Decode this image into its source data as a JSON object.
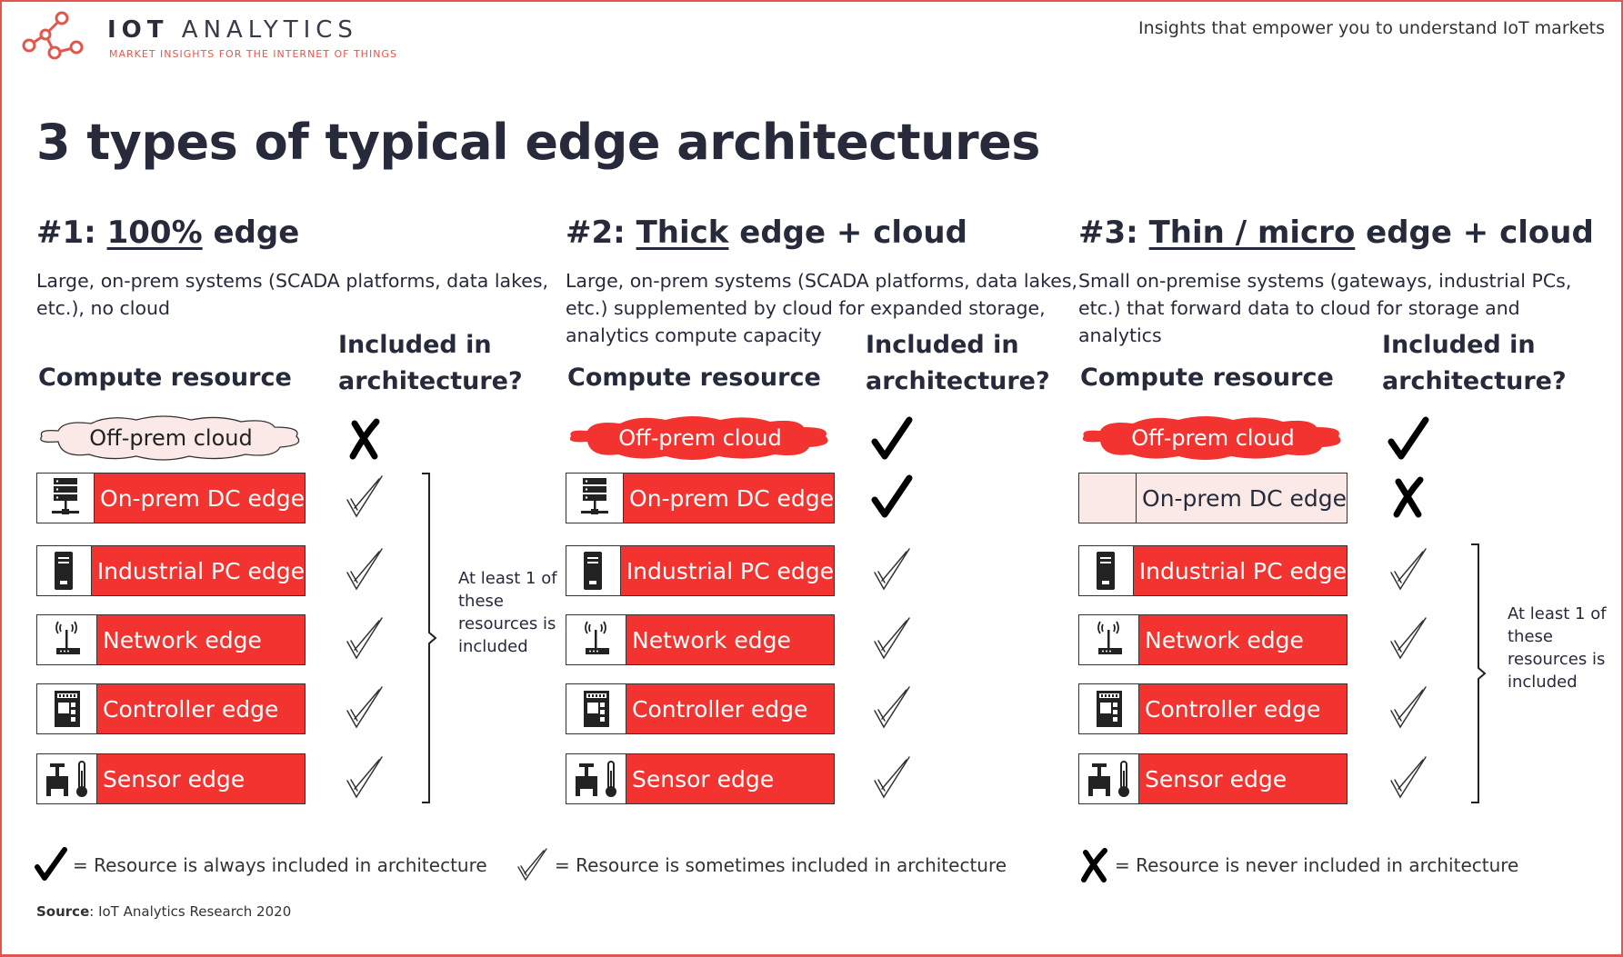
{
  "header": {
    "brand_bold": "IOT",
    "brand_light": "ANALYTICS",
    "brand_subtitle": "MARKET INSIGHTS FOR THE INTERNET OF THINGS",
    "tagline": "Insights that empower you to understand IoT markets"
  },
  "title": "3 types of typical edge architectures",
  "labels": {
    "compute_resource": "Compute resource",
    "included_line1": "Included in",
    "included_line2": "architecture?",
    "note": "At least 1 of these resources is included"
  },
  "resources": {
    "cloud": "Off-prem cloud",
    "dc": "On-prem DC edge",
    "ipc": "Industrial PC edge",
    "network": "Network edge",
    "controller": "Controller edge",
    "sensor": "Sensor edge"
  },
  "icons": {
    "dc": "server-rack-icon",
    "ipc": "industrial-pc-icon",
    "network": "wireless-router-icon",
    "controller": "controller-chip-icon",
    "sensor": "valve-thermometer-icon"
  },
  "columns": [
    {
      "num": "#1:",
      "underlined": "100%",
      "rest": "edge",
      "desc": "Large, on-prem systems (SCADA platforms, data lakes, etc.), no cloud",
      "cloud_included": "never",
      "dc_included": "sometimes",
      "others_included": "sometimes"
    },
    {
      "num": "#2:",
      "underlined": "Thick",
      "rest": "edge + cloud",
      "desc": "Large, on-prem systems (SCADA platforms, data lakes, etc.) supplemented by cloud for expanded storage, analytics compute capacity",
      "cloud_included": "always",
      "dc_included": "always",
      "others_included": "sometimes"
    },
    {
      "num": "#3:",
      "underlined": "Thin / micro",
      "rest": "edge + cloud",
      "desc": "Small on-premise systems (gateways, industrial PCs, etc.) that forward data to cloud for storage and analytics",
      "cloud_included": "always",
      "dc_included": "never",
      "others_included": "sometimes"
    }
  ],
  "legend": {
    "always": "= Resource is always included in architecture",
    "sometimes": "= Resource is sometimes included in architecture",
    "never": "= Resource is never included in architecture"
  },
  "source": {
    "label": "Source",
    "text": ": IoT Analytics Research 2020"
  },
  "colors": {
    "accent_red": "#f2332f",
    "brand_red": "#e2574c",
    "pale_pink": "#fbe9e8",
    "text_dark": "#262a3a"
  }
}
